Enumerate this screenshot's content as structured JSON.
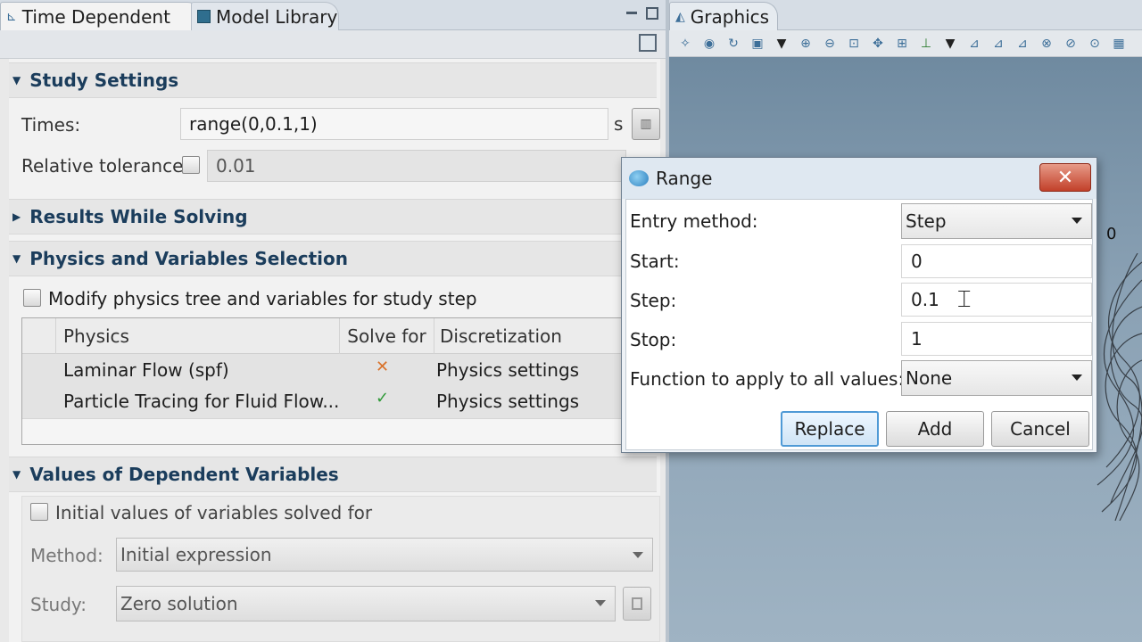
{
  "left_window": {
    "tabs": [
      {
        "label": "Time Dependent"
      },
      {
        "label": "Model Library"
      }
    ],
    "study_settings": {
      "title": "Study Settings",
      "times_label": "Times:",
      "times_value": "range(0,0.1,1)",
      "times_unit": "s",
      "rel_tol_label": "Relative tolerance:",
      "rel_tol_value": "0.01"
    },
    "results_while_solving": {
      "title": "Results While Solving"
    },
    "physics_selection": {
      "title": "Physics and Variables Selection",
      "modify_label": "Modify physics tree and variables for study step",
      "columns": [
        "Physics",
        "Solve for",
        "Discretization"
      ],
      "rows": [
        {
          "physics": "Laminar Flow (spf)",
          "solve_for": "✕",
          "discretization": "Physics settings"
        },
        {
          "physics": "Particle Tracing for Fluid Flow...",
          "solve_for": "✓",
          "discretization": "Physics settings"
        }
      ]
    },
    "dependent_vars": {
      "title": "Values of Dependent Variables",
      "initial_label": "Initial values of variables solved for",
      "method_label": "Method:",
      "method_value": "Initial expression",
      "study_label": "Study:",
      "study_value": "Zero solution"
    }
  },
  "graphics_window": {
    "tab_label": "Graphics",
    "axis_value": "0"
  },
  "range_dialog": {
    "title": "Range",
    "entry_method_label": "Entry method:",
    "entry_method_value": "Step",
    "start_label": "Start:",
    "start_value": "0",
    "step_label": "Step:",
    "step_value": "0.1",
    "stop_label": "Stop:",
    "stop_value": "1",
    "function_label": "Function to apply to all values:",
    "function_value": "None",
    "replace_label": "Replace",
    "add_label": "Add",
    "cancel_label": "Cancel",
    "close_glyph": "✕"
  },
  "colors": {
    "section_title": "#1b3d5c",
    "solve_cross": "#d9722a",
    "solve_check": "#2f9a38",
    "graphics_bg": "#7e97ad"
  }
}
